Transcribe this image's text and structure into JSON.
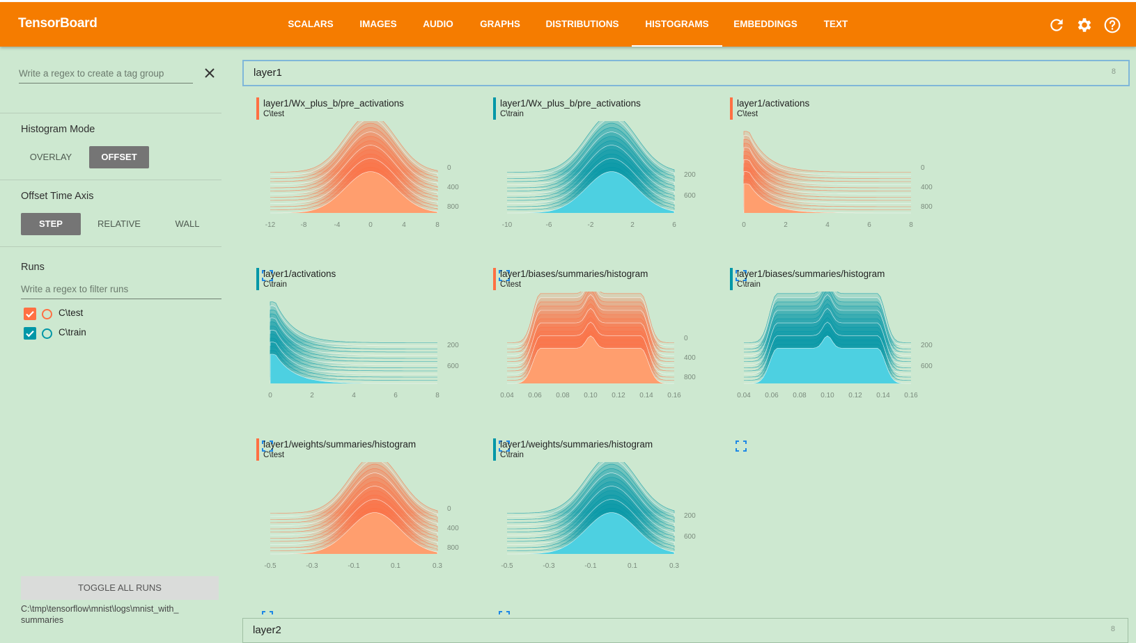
{
  "app": {
    "title": "TensorBoard"
  },
  "nav": {
    "tabs": [
      {
        "label": "SCALARS"
      },
      {
        "label": "IMAGES"
      },
      {
        "label": "AUDIO"
      },
      {
        "label": "GRAPHS"
      },
      {
        "label": "DISTRIBUTIONS"
      },
      {
        "label": "HISTOGRAMS",
        "active": true
      },
      {
        "label": "EMBEDDINGS"
      },
      {
        "label": "TEXT"
      }
    ],
    "icons": [
      "refresh-icon",
      "settings-gear-icon",
      "help-icon"
    ]
  },
  "sidebar": {
    "tag_regex_placeholder": "Write a regex to create a tag group",
    "histogram_mode": {
      "title": "Histogram Mode",
      "options": [
        "OVERLAY",
        "OFFSET"
      ],
      "selected": "OFFSET"
    },
    "offset_axis": {
      "title": "Offset Time Axis",
      "options": [
        "STEP",
        "RELATIVE",
        "WALL"
      ],
      "selected": "STEP"
    },
    "runs": {
      "title": "Runs",
      "filter_placeholder": "Write a regex to filter runs",
      "items": [
        {
          "label": "C\\test",
          "checked": true,
          "color": "#ff7043"
        },
        {
          "label": "C\\train",
          "checked": true,
          "color": "#0097a7"
        }
      ]
    },
    "toggle_label": "TOGGLE ALL RUNS",
    "logdir": "C:\\tmp\\tensorflow\\mnist\\logs\\mnist_with_\nsummaries"
  },
  "groups": [
    {
      "name": "layer1",
      "count": "8"
    },
    {
      "name": "layer2",
      "count": "8"
    }
  ],
  "cards": [
    {
      "tag": "layer1/Wx_plus_b/pre_activations",
      "run": "C\\test"
    },
    {
      "tag": "layer1/Wx_plus_b/pre_activations",
      "run": "C\\train"
    },
    {
      "tag": "layer1/activations",
      "run": "C\\test"
    },
    {
      "tag": "layer1/activations",
      "run": "C\\train"
    },
    {
      "tag": "layer1/biases/summaries/histogram",
      "run": "C\\test"
    },
    {
      "tag": "layer1/biases/summaries/histogram",
      "run": "C\\train"
    },
    {
      "tag": "layer1/weights/summaries/histogram",
      "run": "C\\test"
    },
    {
      "tag": "layer1/weights/summaries/histogram",
      "run": "C\\train"
    }
  ],
  "colors": {
    "test": "#ff7043",
    "train": "#0097a7",
    "accent": "#f57c00",
    "background": "#cde8d0"
  },
  "chart_data": [
    {
      "type": "area",
      "run": "C\\test",
      "shape": "gaussian",
      "center": 0,
      "xlim": [
        -12,
        8
      ],
      "x_ticks": [
        "-12",
        "-8",
        "-4",
        "0",
        "4",
        "8"
      ],
      "y_ticks": [
        "0",
        "400",
        "800"
      ]
    },
    {
      "type": "area",
      "run": "C\\train",
      "shape": "gaussian",
      "center": 0,
      "xlim": [
        -10,
        6
      ],
      "x_ticks": [
        "-10",
        "-6",
        "-2",
        "2",
        "6"
      ],
      "y_ticks": [
        "200",
        "600"
      ]
    },
    {
      "type": "area",
      "run": "C\\test",
      "shape": "decay",
      "center": 0,
      "xlim": [
        0,
        8
      ],
      "x_ticks": [
        "0",
        "2",
        "4",
        "6",
        "8"
      ],
      "y_ticks": [
        "0",
        "400",
        "800"
      ]
    },
    {
      "type": "area",
      "run": "C\\train",
      "shape": "decay",
      "center": 0,
      "xlim": [
        0,
        8
      ],
      "x_ticks": [
        "0",
        "2",
        "4",
        "6",
        "8"
      ],
      "y_ticks": [
        "200",
        "600"
      ]
    },
    {
      "type": "area",
      "run": "C\\test",
      "shape": "plateau",
      "center": 0.1,
      "xlim": [
        0.04,
        0.16
      ],
      "x_ticks": [
        "0.04",
        "0.06",
        "0.08",
        "0.10",
        "0.12",
        "0.14",
        "0.16"
      ],
      "y_ticks": [
        "0",
        "400",
        "800"
      ]
    },
    {
      "type": "area",
      "run": "C\\train",
      "shape": "plateau",
      "center": 0.1,
      "xlim": [
        0.04,
        0.16
      ],
      "x_ticks": [
        "0.04",
        "0.06",
        "0.08",
        "0.10",
        "0.12",
        "0.14",
        "0.16"
      ],
      "y_ticks": [
        "200",
        "600"
      ]
    },
    {
      "type": "area",
      "run": "C\\test",
      "shape": "gaussian",
      "center": 0,
      "xlim": [
        -0.5,
        0.3
      ],
      "x_ticks": [
        "-0.5",
        "-0.3",
        "-0.1",
        "0.1",
        "0.3"
      ],
      "y_ticks": [
        "0",
        "400",
        "800"
      ]
    },
    {
      "type": "area",
      "run": "C\\train",
      "shape": "gaussian",
      "center": 0,
      "xlim": [
        -0.5,
        0.3
      ],
      "x_ticks": [
        "-0.5",
        "-0.3",
        "-0.1",
        "0.1",
        "0.3"
      ],
      "y_ticks": [
        "200",
        "600"
      ]
    }
  ]
}
